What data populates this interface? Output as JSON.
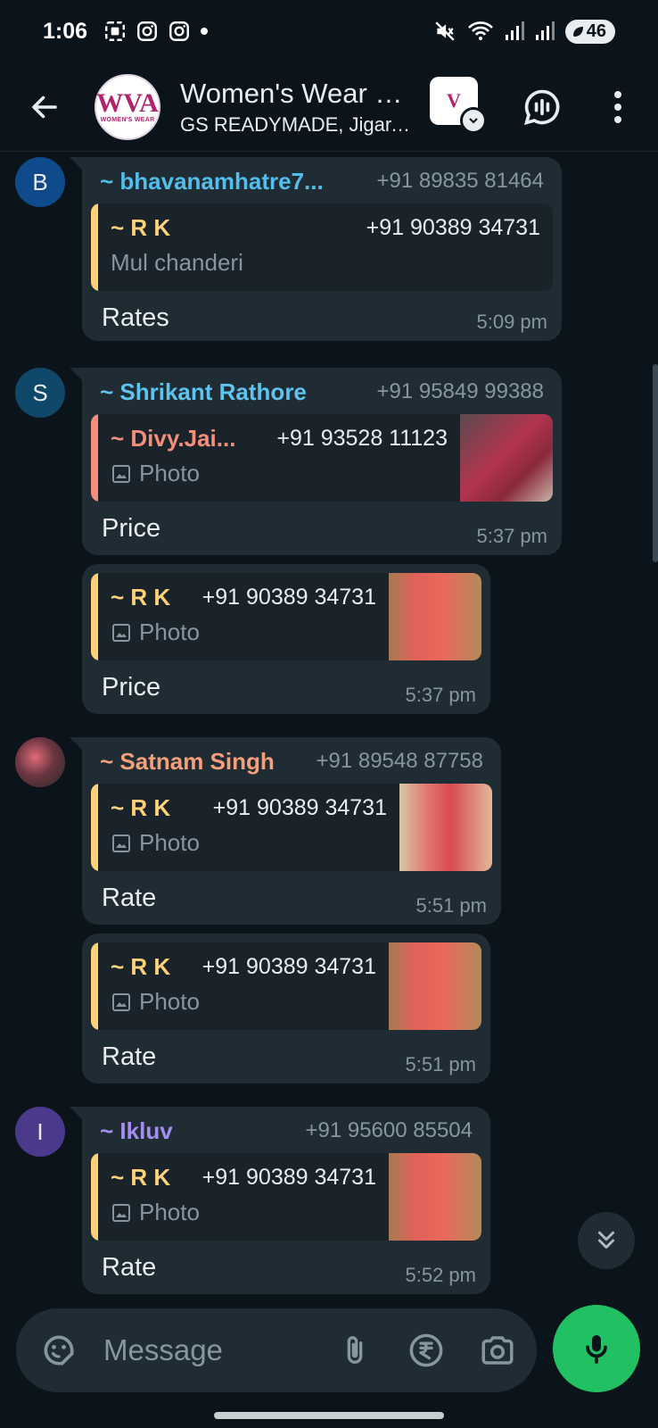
{
  "status_bar": {
    "time": "1:06",
    "battery": "46"
  },
  "header": {
    "title": "Women's Wear Business Community",
    "subtitle": "GS READYMADE, Jigar, You",
    "logo_mark": "WVA",
    "logo_text": "WOMEN'S WEAR"
  },
  "messages": [
    {
      "sender": "~ bhavanamhatre7...",
      "phone": "+91 89835 81464",
      "avatar_letter": "B",
      "quote": {
        "name": "~ R K",
        "phone": "+91 90389 34731",
        "text": "Mul chanderi"
      },
      "text": "Rates",
      "time": "5:09 pm"
    },
    {
      "sender": "~ Shrikant Rathore",
      "phone": "+91 95849 99388",
      "avatar_letter": "S",
      "quote": {
        "name": "~ Divy.Jai...",
        "phone": "+91 93528 11123",
        "text": "Photo"
      },
      "text": "Price",
      "time": "5:37 pm"
    },
    {
      "quote": {
        "name": "~ R K",
        "phone": "+91 90389 34731",
        "text": "Photo"
      },
      "text": "Price",
      "time": "5:37 pm"
    },
    {
      "sender": "~ Satnam Singh",
      "phone": "+91 89548 87758",
      "quote": {
        "name": "~ R K",
        "phone": "+91 90389 34731",
        "text": "Photo"
      },
      "text": "Rate",
      "time": "5:51 pm"
    },
    {
      "quote": {
        "name": "~ R K",
        "phone": "+91 90389 34731",
        "text": "Photo"
      },
      "text": "Rate",
      "time": "5:51 pm"
    },
    {
      "sender": "~ Ikluv",
      "phone": "+91 95600 85504",
      "avatar_letter": "I",
      "quote": {
        "name": "~ R K",
        "phone": "+91 90389 34731",
        "text": "Photo"
      },
      "text": "Rate",
      "time": "5:52 pm"
    }
  ],
  "composer": {
    "placeholder": "Message"
  },
  "colors": {
    "background": "#0b141a",
    "bubble": "#202c33",
    "quote_bg": "#1a2329",
    "name_blue": "#53bdeb",
    "name_light_blue": "#5fc3f0",
    "name_orange": "#f5a07a",
    "name_purple": "#a68ef0",
    "quote_yellow": "#ffd279",
    "quote_salmon": "#f58f7c",
    "mic_green": "#21c063"
  }
}
